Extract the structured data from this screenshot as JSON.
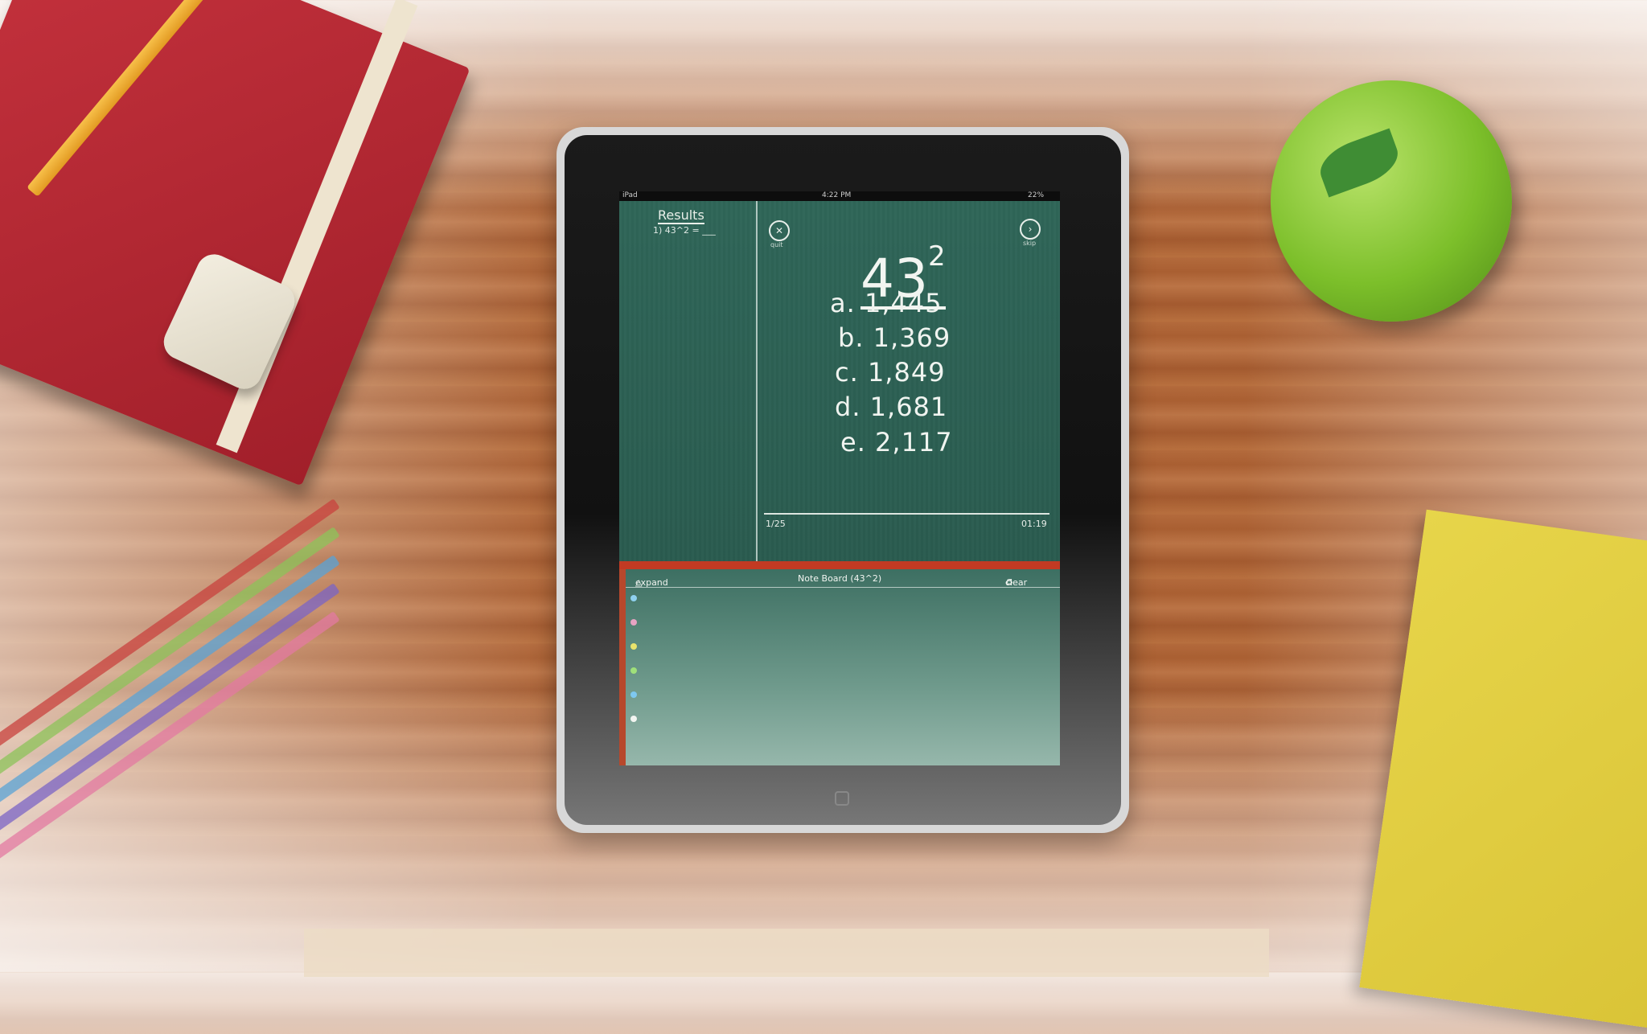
{
  "status_bar": {
    "device": "iPad",
    "time": "4:22 PM",
    "battery": "22%"
  },
  "results_panel": {
    "title": "Results",
    "first_entry": "1) 43^2 = ___"
  },
  "controls": {
    "quit_label": "quit",
    "skip_label": "skip",
    "quit_icon": "close-circle-icon",
    "skip_icon": "arrow-right-circle-icon"
  },
  "problem": {
    "base": "43",
    "exponent": "2"
  },
  "answers": [
    {
      "label": "a. 1,445"
    },
    {
      "label": "b. 1,369"
    },
    {
      "label": "c. 1,849"
    },
    {
      "label": "d. 1,681"
    },
    {
      "label": "e. 2,117"
    }
  ],
  "progress": {
    "count": "1/25",
    "timer": "01:19"
  },
  "note_board": {
    "expand_label": "expand",
    "title": "Note Board (43^2)",
    "clear_label": "clear"
  },
  "colors": {
    "chalkboard": "#2c5a4e",
    "tray": "#c23a23",
    "chalk": "#f2f5f1"
  }
}
